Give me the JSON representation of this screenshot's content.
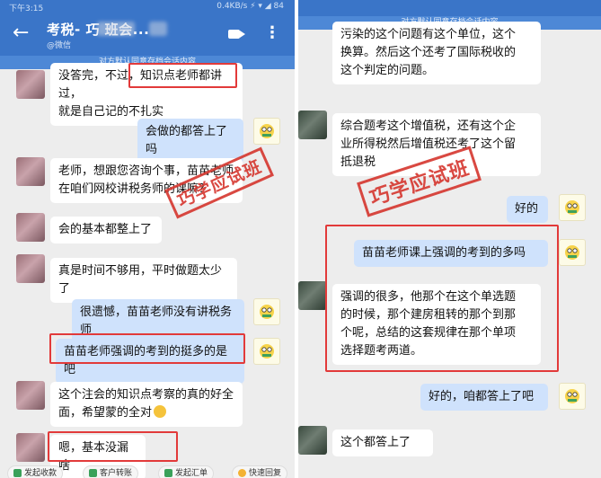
{
  "left": {
    "status_time": "下午3:15",
    "status_right": "0.4KB/s ⚡ ▾ ◢ 84",
    "title": "考税-  巧  班会...",
    "subtitle": "@微信",
    "notice": "对方默认同意存档会话内容",
    "messages": [
      {
        "from": "other",
        "text": "没答完，不过，知识点老师都讲过，\n就是自己记的不扎实"
      },
      {
        "from": "self",
        "text": "会做的都答上了吗"
      },
      {
        "from": "other",
        "text": "老师，想跟您咨询个事，苗苗老师\n在咱们网校讲税务师的课嘛？"
      },
      {
        "from": "other",
        "text": "会的基本都整上了"
      },
      {
        "from": "other",
        "text": "真是时间不够用，平时做题太少了"
      },
      {
        "from": "self",
        "text": "很遗憾，苗苗老师没有讲税务师"
      },
      {
        "from": "self",
        "text": "苗苗老师强调的考到的挺多的是吧"
      },
      {
        "from": "other",
        "text": "这个注会的知识点考察的真的好全\n面，希望蒙的全对"
      },
      {
        "from": "other",
        "text": "嗯，基本没漏啥"
      }
    ],
    "stamp": "巧学应试班",
    "bottom_chips": [
      "发起收款",
      "客户转账",
      "发起汇单",
      "快速回复"
    ]
  },
  "right": {
    "notice": "对方默认同意存档会话内容",
    "messages": [
      {
        "from": "other",
        "text": "污染的这个问题有这个单位，这个\n换算。然后这个还考了国际税收的\n这个判定的问题。"
      },
      {
        "from": "other",
        "text": "综合题考这个增值税，还有这个企\n业所得税然后增值税还考了这个留\n抵退税"
      },
      {
        "from": "self",
        "text": "好的"
      },
      {
        "from": "self",
        "text": "苗苗老师课上强调的考到的多吗"
      },
      {
        "from": "other",
        "text": "强调的很多，他那个在这个单选题\n的时候，那个建房租转的那个到那\n个呢，总结的这套规律在那个单项\n选择题考两道。"
      },
      {
        "from": "self",
        "text": "好的，咱都答上了吧"
      },
      {
        "from": "other",
        "text": "这个都答上了"
      }
    ],
    "stamp": "巧学应试班"
  },
  "colors": {
    "header_blue": "#3a75c8",
    "notice_blue": "#4d88d6",
    "self_bubble": "#cfe2fc",
    "highlight_red": "#e23a3a",
    "stamp_red": "#d63a32"
  },
  "icons": [
    "back-arrow-icon",
    "video-call-icon",
    "more-dots-icon",
    "user-avatar-icon"
  ]
}
